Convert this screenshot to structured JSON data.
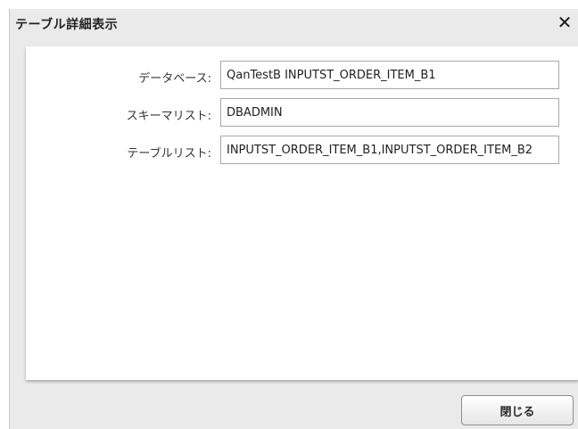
{
  "dialog": {
    "title": "テーブル詳細表示",
    "close_icon": "close-icon",
    "close_glyph": "✕"
  },
  "form": {
    "database": {
      "label": "データベース:",
      "value": "QanTestB INPUTST_ORDER_ITEM_B1"
    },
    "schema_list": {
      "label": "スキーマリスト:",
      "value": "DBADMIN"
    },
    "table_list": {
      "label": "テーブルリスト:",
      "value": "INPUTST_ORDER_ITEM_B1,INPUTST_ORDER_ITEM_B2"
    }
  },
  "footer": {
    "close_label": "閉じる"
  }
}
